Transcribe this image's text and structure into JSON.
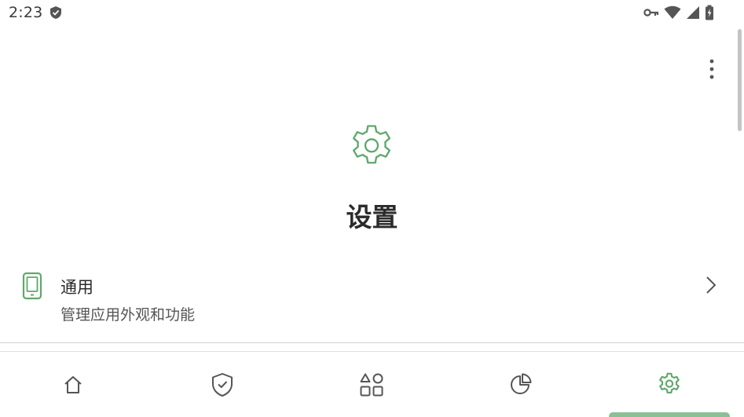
{
  "status_bar": {
    "time": "2:23",
    "icons": [
      "shield-icon",
      "vpn-key-icon",
      "wifi-icon",
      "cell-signal-icon",
      "battery-charging-icon"
    ]
  },
  "theme": {
    "accent": "#5fa86c",
    "icon_gray": "#555555",
    "indicator": "#8bbf95"
  },
  "header": {
    "icon": "gear-icon",
    "title": "设置",
    "overflow_icon": "more-vert-icon"
  },
  "settings_list": [
    {
      "icon": "phone-icon",
      "title": "通用",
      "subtitle": "管理应用外观和功能",
      "trailing_icon": "chevron-right-icon"
    }
  ],
  "bottom_nav": {
    "items": [
      {
        "name": "home",
        "icon": "home-icon"
      },
      {
        "name": "protection",
        "icon": "shield-check-icon"
      },
      {
        "name": "apps",
        "icon": "apps-icon"
      },
      {
        "name": "statistics",
        "icon": "pie-chart-icon"
      },
      {
        "name": "settings",
        "icon": "gear-icon",
        "selected": true
      }
    ]
  }
}
